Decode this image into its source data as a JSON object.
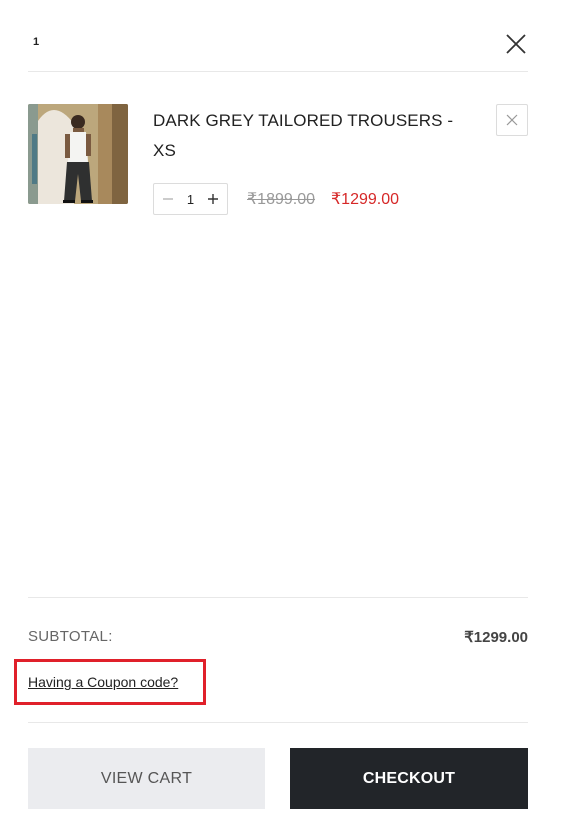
{
  "header": {
    "item_count": "1",
    "close_icon": "close-icon"
  },
  "cart_item": {
    "title": "DARK GREY TAILORED TROUSERS - XS",
    "image_icon": "product-thumbnail",
    "quantity": "1",
    "original_price": "₹1899.00",
    "sale_price": "₹1299.00",
    "sale_color": "#d62828"
  },
  "summary": {
    "subtotal_label": "SUBTOTAL:",
    "subtotal_value": "₹1299.00",
    "coupon_link": "Having a Coupon code?",
    "highlight_color": "#e0202a"
  },
  "actions": {
    "view_cart_label": "VIEW CART",
    "checkout_label": "CHECKOUT"
  }
}
